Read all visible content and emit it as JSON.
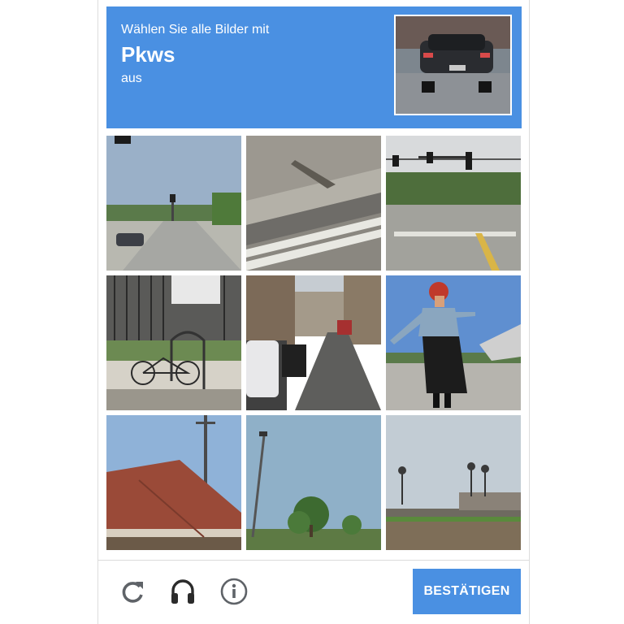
{
  "header": {
    "instruction_prefix": "Wählen Sie alle Bilder mit",
    "target_object": "Pkws",
    "instruction_suffix": "aus",
    "background_color": "#4a90e2"
  },
  "grid": {
    "rows": 3,
    "columns": 3,
    "tiles": [
      {
        "index": 1,
        "depicts": "street with car and traffic lights"
      },
      {
        "index": 2,
        "depicts": "curb and road markings"
      },
      {
        "index": 3,
        "depicts": "intersection with traffic lights"
      },
      {
        "index": 4,
        "depicts": "bicycle at fence"
      },
      {
        "index": 5,
        "depicts": "city street with parked cars"
      },
      {
        "index": 6,
        "depicts": "person on road"
      },
      {
        "index": 7,
        "depicts": "roof"
      },
      {
        "index": 8,
        "depicts": "tree and pole"
      },
      {
        "index": 9,
        "depicts": "palm trees and field"
      }
    ]
  },
  "footer": {
    "reload_icon": "reload-icon",
    "audio_icon": "headphones-icon",
    "info_icon": "info-icon",
    "confirm_label": "BESTÄTIGEN",
    "confirm_color": "#4a90e2"
  }
}
